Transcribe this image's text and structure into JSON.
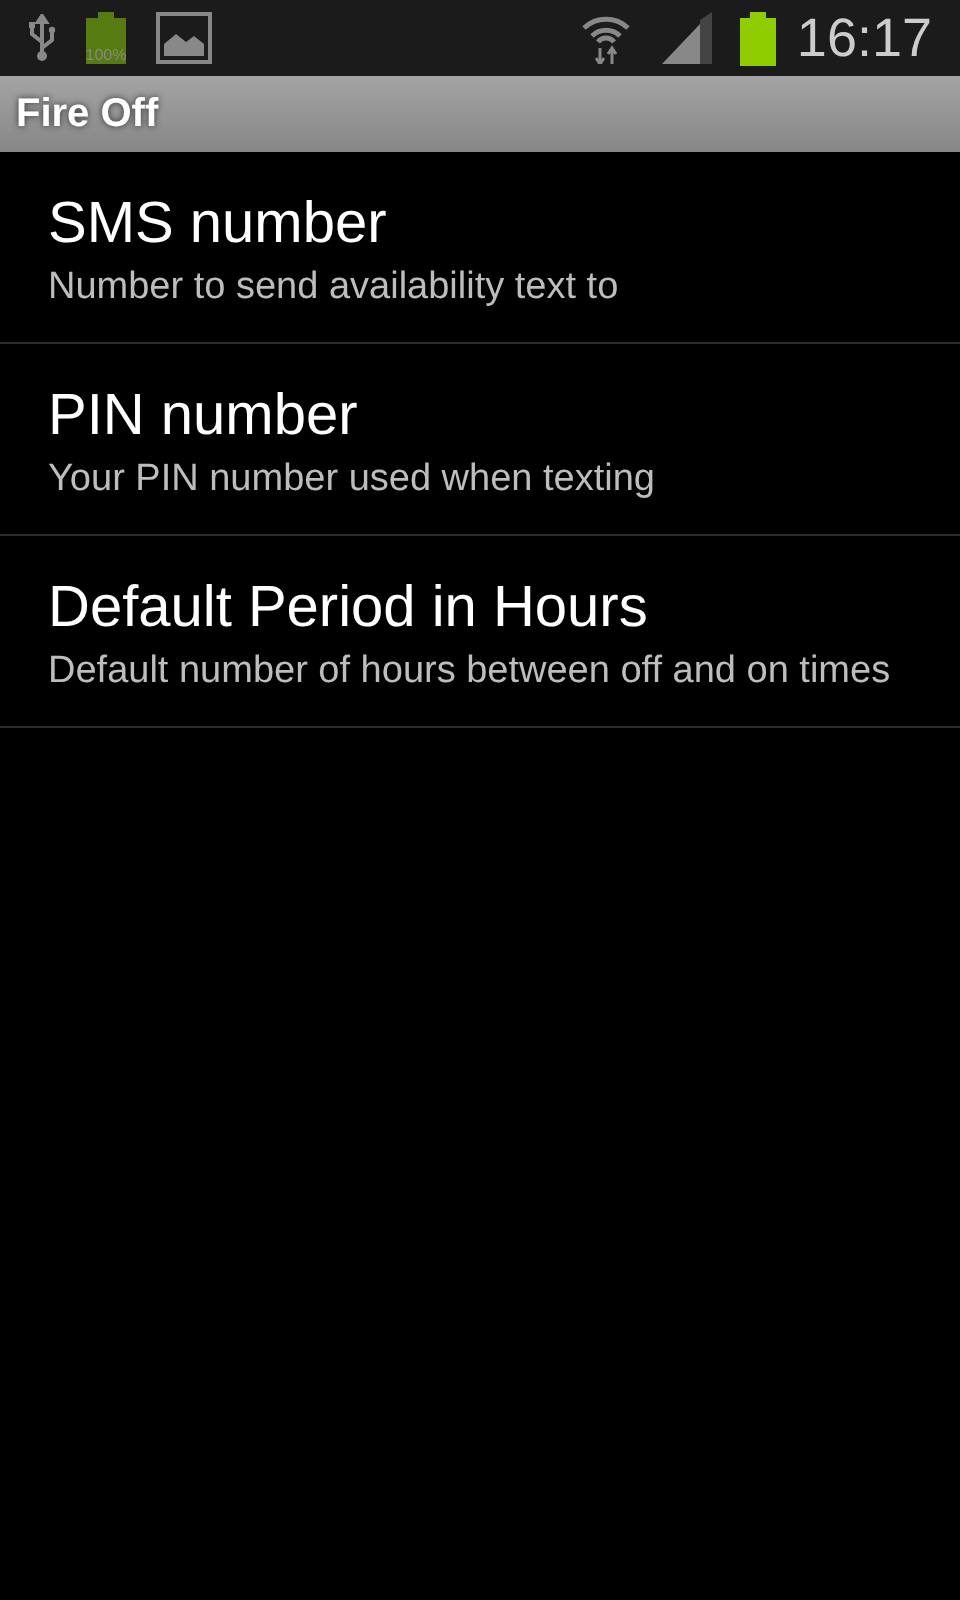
{
  "status_bar": {
    "battery_label": "100%",
    "time": "16:17"
  },
  "title_bar": {
    "title": "Fire Off"
  },
  "preferences": [
    {
      "title": "SMS number",
      "summary": "Number to send availability text to"
    },
    {
      "title": "PIN number",
      "summary": "Your PIN number used when texting"
    },
    {
      "title": "Default Period in Hours",
      "summary": "Default number of hours between off and on times"
    }
  ]
}
